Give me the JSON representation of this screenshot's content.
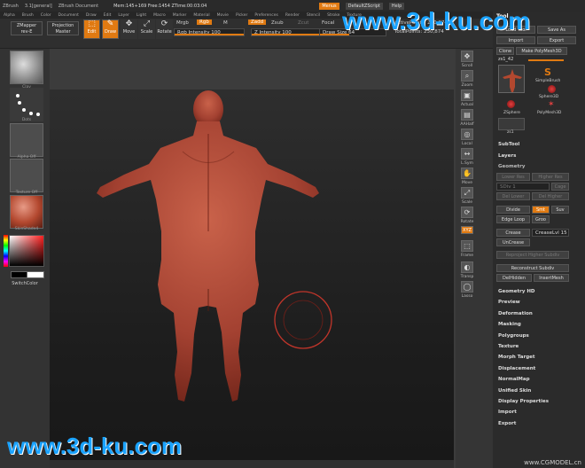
{
  "menubar": {
    "app": "ZBrush",
    "version": "3.1[general]",
    "doc": "ZBrush Document",
    "mem": "Mem:145+169 Free:1454 ZTime:00:03:04",
    "menus_btn": "Menus",
    "script": "DefaultZScript",
    "help": "Help",
    "items": [
      "Alpha",
      "Brush",
      "Color",
      "Document",
      "Draw",
      "Edit",
      "Layer",
      "Light",
      "Macro",
      "Marker",
      "Material",
      "Movie",
      "Picker",
      "Preferences",
      "Render",
      "Stencil",
      "Stroke",
      "Texture"
    ]
  },
  "toolbar": {
    "zmapper": "ZMapper",
    "zmapper2": "rev-E",
    "projection": "Projection",
    "projection2": "Master",
    "edit": "Edit",
    "draw": "Draw",
    "move": "Move",
    "scale": "Scale",
    "rotate": "Rotate",
    "mrgb": "Mrgb",
    "rgb": "Rgb",
    "m": "M",
    "rgb_intensity_label": "Rgb Intensity",
    "rgb_intensity": "100",
    "rgb_intensity_pct": 100,
    "zadd": "Zadd",
    "zsub": "Zsub",
    "zcut": "Zcut",
    "z_intensity_label": "Z Intensity",
    "z_intensity": "100",
    "z_intensity_pct": 100,
    "focal": "Focal",
    "draw_size_label": "Draw Size",
    "draw_size": "64",
    "draw_size_pct": 45,
    "active_points": "ActivePoints: 230,874",
    "total_points": "TotalPoints: 230,874"
  },
  "leftpanel": {
    "brush_label": "Clay",
    "stroke_label": "Dots",
    "alpha_label": "Alpha Off",
    "texture_label": "Texture Off",
    "material_label": "SkinShade4",
    "switch_color": "SwitchColor",
    "colors": {
      "fg": "#000000",
      "bg": "#ffffff",
      "picker_hue": "#ff2020"
    }
  },
  "rightdock": {
    "scroll": "Scroll",
    "zoom": "Zoom",
    "actual": "Actual",
    "aahalf": "AAHalf",
    "local": "Local",
    "lsym": "L.Sym",
    "move": "Move",
    "scale": "Scale",
    "rotate": "Rotate",
    "xyz": "XYZ",
    "frame": "Frame",
    "transp": "Transp",
    "lasso": "Lasso"
  },
  "toolpanel": {
    "title": "Tool",
    "load": "Load Tool",
    "save": "Save As",
    "import": "Import",
    "export": "Export",
    "clone": "Clone",
    "make": "Make PolyMesh3D",
    "current_tool": "zs1_42",
    "tool_count": "R",
    "tools": [
      "SimpleBrush",
      "Sphere3D",
      "ZSphere",
      "PolyMesh3D",
      "zs1"
    ],
    "sections": [
      "SubTool",
      "Layers",
      "Geometry"
    ],
    "geometry": {
      "lower_res": "Lower Res",
      "higher_res": "Higher Res",
      "sdiv": "SDiv",
      "sdiv_val": "1",
      "cage": "Cage",
      "del_lower": "Del Lower",
      "del_higher": "Del Higher",
      "divide": "Divide",
      "smt": "Smt",
      "suv": "Suv",
      "edge_loop": "Edge Loop",
      "grou": "Groo",
      "crease": "Crease",
      "crease_lvl": "CreaseLvl",
      "crease_val": "15",
      "uncrease": "UnCrease",
      "reproject": "Reproject Higher Subdiv",
      "reconstruct": "Reconstruct Subdiv",
      "delhidden": "DelHidden",
      "insertmesh": "InsertMesh"
    },
    "more_sections": [
      "Geometry HD",
      "Preview",
      "Deformation",
      "Masking",
      "Polygroups",
      "Texture",
      "Morph Target",
      "Displacement",
      "NormalMap",
      "Unified Skin",
      "Display Properties",
      "Import",
      "Export"
    ]
  },
  "watermark": {
    "top": "www.3d-ku.com",
    "bottom": "www.3d-ku.com",
    "corner": "www.CGMODEL.cn"
  }
}
